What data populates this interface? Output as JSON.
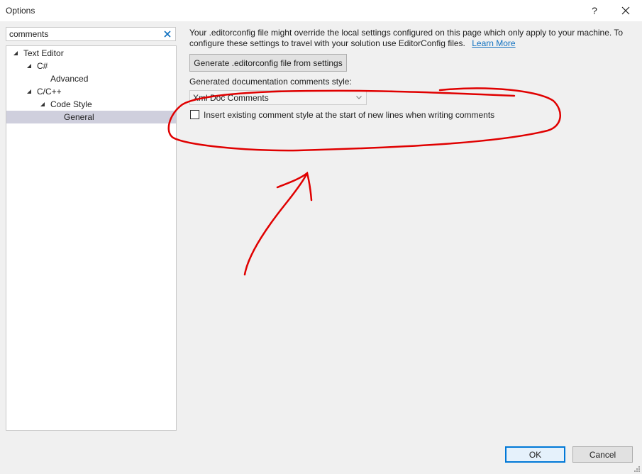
{
  "window": {
    "title": "Options",
    "help_label": "?"
  },
  "search": {
    "value": "comments"
  },
  "tree": {
    "items": [
      {
        "label": "Text Editor",
        "expanded": true
      },
      {
        "label": "C#",
        "expanded": true
      },
      {
        "label": "Advanced"
      },
      {
        "label": "C/C++",
        "expanded": true
      },
      {
        "label": "Code Style",
        "expanded": true
      },
      {
        "label": "General",
        "selected": true
      }
    ]
  },
  "main": {
    "info_text": "Your .editorconfig file might override the local settings configured on this page which only apply to your machine. To configure these settings to travel with your solution use EditorConfig files.",
    "learn_more_label": "Learn More",
    "generate_button_label": "Generate .editorconfig file from settings",
    "doc_style_label": "Generated documentation comments style:",
    "doc_style_value": "Xml Doc Comments",
    "insert_style_label": "Insert existing comment style at the start of new lines when writing comments",
    "insert_style_checked": false
  },
  "footer": {
    "ok_label": "OK",
    "cancel_label": "Cancel"
  },
  "colors": {
    "accent": "#0078d7",
    "link": "#0e70c0",
    "selection": "#cfcfdd",
    "annotation": "#e00000"
  },
  "icons": {
    "close": "close-icon",
    "clear": "clear-icon",
    "tree_expand": "expanded-triangle-icon",
    "dropdown": "chevron-down-icon"
  }
}
